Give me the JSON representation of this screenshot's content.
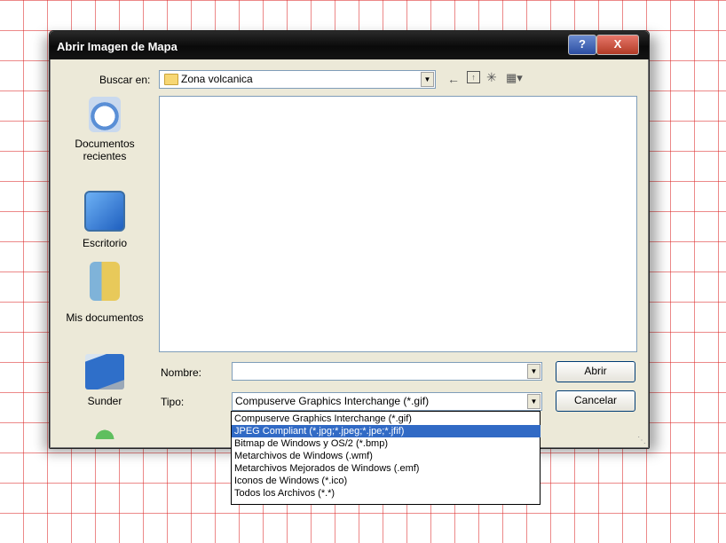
{
  "dialog": {
    "title": "Abrir Imagen de Mapa",
    "help_label": "?",
    "close_label": "X"
  },
  "lookin": {
    "label": "Buscar en:",
    "value": "Zona volcanica"
  },
  "toolbar": {
    "back_icon": "back-arrow-icon",
    "up_icon": "up-folder-icon",
    "newfolder_icon": "new-folder-icon",
    "views_icon": "views-menu-icon"
  },
  "places": [
    {
      "label": "Documentos recientes",
      "icon": "recent-documents-icon"
    },
    {
      "label": "Escritorio",
      "icon": "desktop-icon"
    },
    {
      "label": "Mis documentos",
      "icon": "my-documents-icon"
    },
    {
      "label": "Sunder",
      "icon": "my-computer-icon"
    }
  ],
  "filename": {
    "label": "Nombre:",
    "value": ""
  },
  "filetype": {
    "label": "Tipo:",
    "value": "Compuserve Graphics Interchange (*.gif)",
    "options": [
      "Compuserve Graphics Interchange (*.gif)",
      "JPEG Compliant (*.jpg;*.jpeg;*.jpe;*.jfif)",
      "Bitmap de Windows y OS/2 (*.bmp)",
      "Metarchivos de Windows (.wmf)",
      "Metarchivos Mejorados de Windows (.emf)",
      "Iconos de Windows (*.ico)",
      "Todos los Archivos (*.*)"
    ],
    "selected_index": 1
  },
  "buttons": {
    "open": "Abrir",
    "cancel": "Cancelar"
  },
  "colors": {
    "selection": "#316ac5",
    "dialog_bg": "#ece9d8",
    "grid_lines": "#dc2828"
  }
}
